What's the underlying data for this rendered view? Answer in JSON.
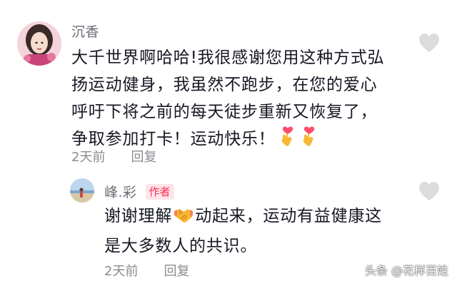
{
  "comment": {
    "username": "沉香",
    "lines": [
      "大千世界啊哈哈!我很感谢您用这种方式弘",
      "扬运动健身，我虽然不跑步，在您的爱心",
      "呼吁下将之前的每天徒步重新又恢复了，",
      "争取参加打卡！运动快乐！"
    ],
    "trailing_emojis": [
      "finger-heart-emoji",
      "finger-heart-emoji"
    ],
    "time": "2天前",
    "reply_label": "回复",
    "like_icon": "heart-icon"
  },
  "reply": {
    "username": "峰.彩",
    "badge": "作者",
    "lines_parts": [
      {
        "before": "谢谢理解",
        "emoji": "handshake-emoji",
        "after": "动起来，运动有益健康这"
      }
    ],
    "line2": "是大多数人的共识。",
    "time": "2天前",
    "reply_label": "回复",
    "like_icon": "heart-icon"
  },
  "watermark": "头条 @花样百姓",
  "colors": {
    "text": "#161823",
    "secondary": "#8a8b91",
    "badge_text": "#fe2c55",
    "badge_bg": "#fde5ea",
    "like_icon": "#dcdcdc"
  }
}
